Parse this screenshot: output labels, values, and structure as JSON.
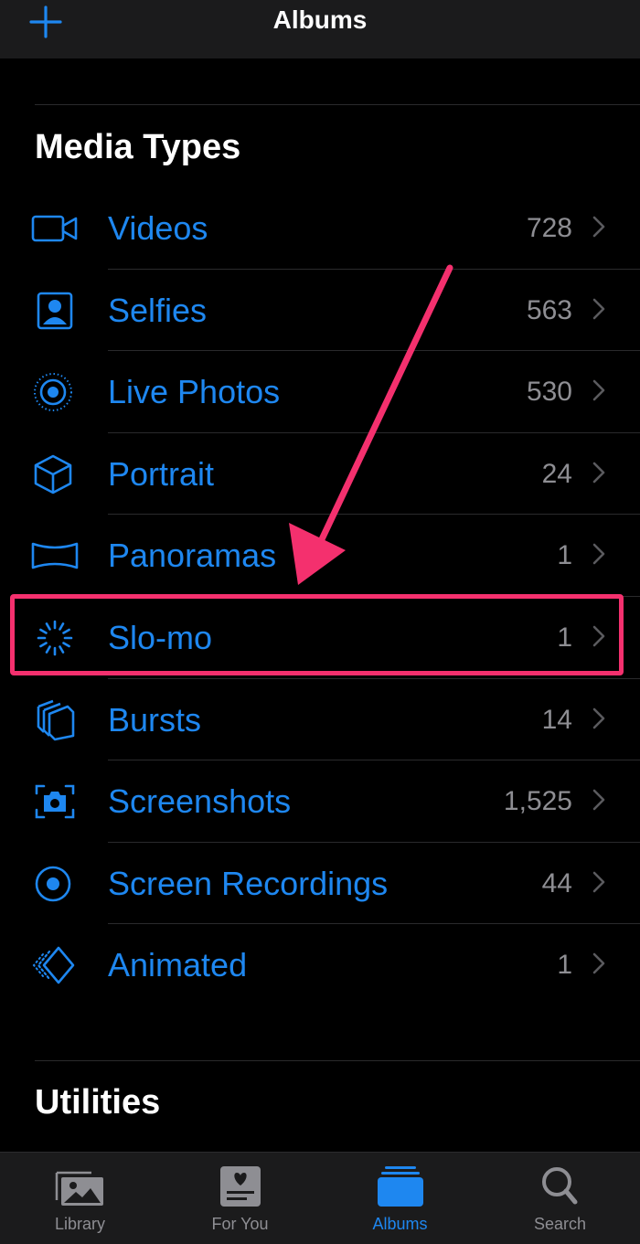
{
  "nav": {
    "title": "Albums",
    "add_icon": "plus-icon"
  },
  "sections": {
    "media_types": "Media Types",
    "utilities": "Utilities"
  },
  "media_types": [
    {
      "icon": "video-icon",
      "label": "Videos",
      "count": "728"
    },
    {
      "icon": "selfie-icon",
      "label": "Selfies",
      "count": "563"
    },
    {
      "icon": "live-photo-icon",
      "label": "Live Photos",
      "count": "530"
    },
    {
      "icon": "portrait-cube-icon",
      "label": "Portrait",
      "count": "24"
    },
    {
      "icon": "panorama-icon",
      "label": "Panoramas",
      "count": "1"
    },
    {
      "icon": "slo-mo-icon",
      "label": "Slo-mo",
      "count": "1"
    },
    {
      "icon": "bursts-icon",
      "label": "Bursts",
      "count": "14"
    },
    {
      "icon": "screenshot-icon",
      "label": "Screenshots",
      "count": "1,525"
    },
    {
      "icon": "screen-recording-icon",
      "label": "Screen Recordings",
      "count": "44"
    },
    {
      "icon": "animated-icon",
      "label": "Animated",
      "count": "1"
    }
  ],
  "highlighted_item": "Slo-mo",
  "tabs": [
    {
      "icon": "library-photos-icon",
      "label": "Library",
      "active": false
    },
    {
      "icon": "for-you-icon",
      "label": "For You",
      "active": false
    },
    {
      "icon": "albums-icon",
      "label": "Albums",
      "active": true
    },
    {
      "icon": "search-icon",
      "label": "Search",
      "active": false
    }
  ],
  "colors": {
    "accent": "#1e87f0",
    "annotation": "#f4306e",
    "secondary_text": "#8e8e93",
    "bar_background": "#1b1b1c",
    "background": "#000000"
  }
}
